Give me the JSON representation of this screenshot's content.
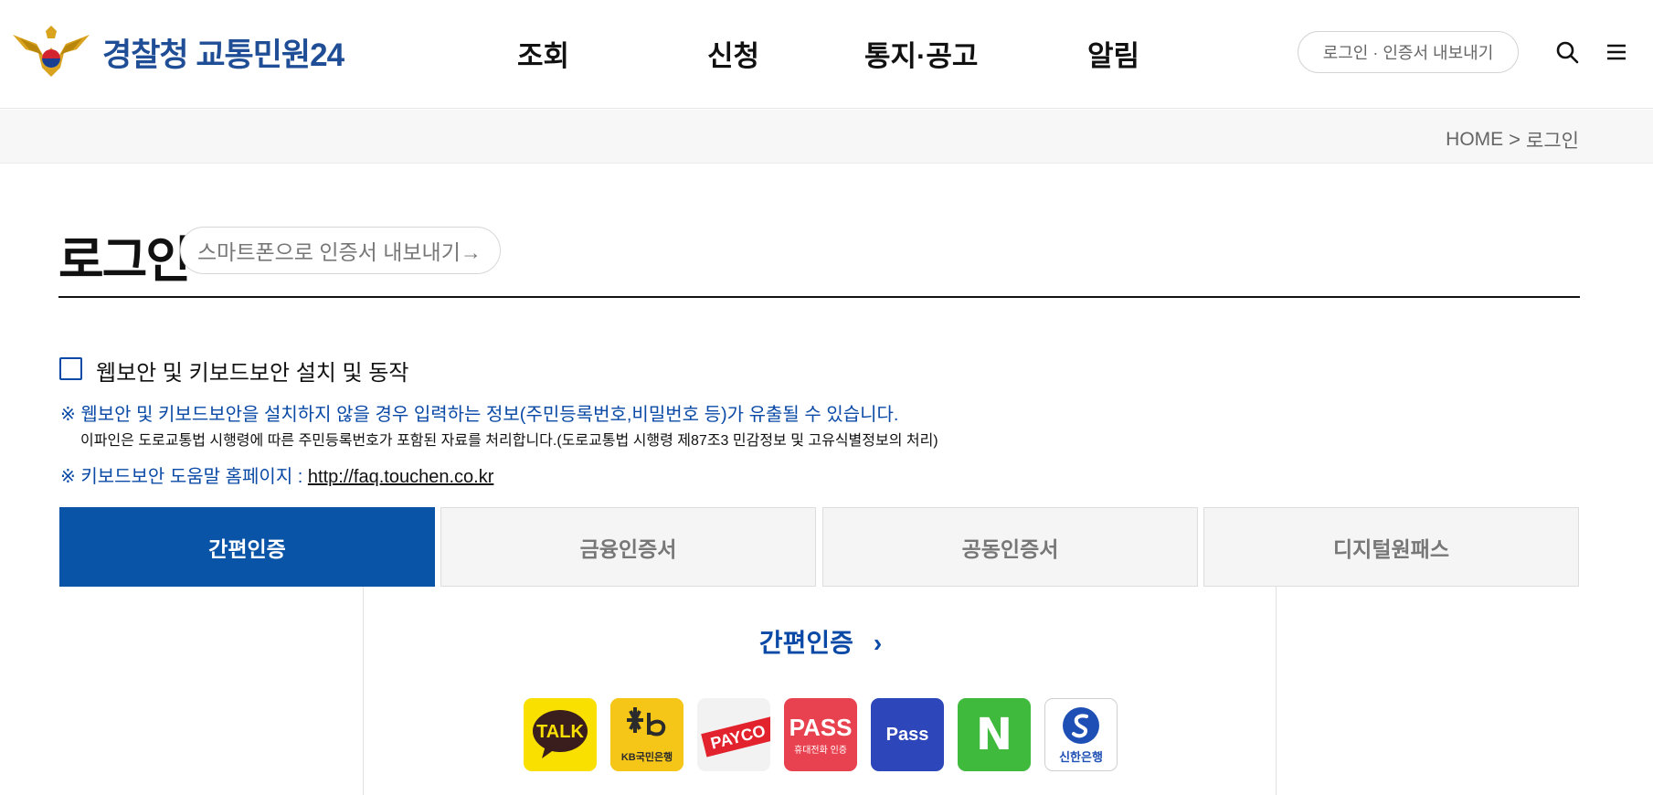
{
  "header": {
    "logo_text": "경찰청 교통민원24",
    "nav": [
      "조회",
      "신청",
      "통지·공고",
      "알림"
    ],
    "login_button": "로그인 · 인증서 내보내기",
    "search_icon": "search-icon",
    "menu_icon": "hamburger-menu-icon"
  },
  "breadcrumb": {
    "home": "HOME",
    "separator": ">",
    "current": "로그인"
  },
  "page": {
    "title": "로그인",
    "export_link": "스마트폰으로 인증서 내보내기→"
  },
  "security": {
    "checkbox_label": "웹보안 및 키보드보안 설치 및 동작",
    "checked": false,
    "notice1": "※ 웹보안 및 키보드보안을 설치하지 않을 경우 입력하는 정보(주민등록번호,비밀번호 등)가 유출될 수 있습니다.",
    "notice2": "이파인은 도로교통법 시행령에 따른 주민등록번호가 포함된 자료를 처리합니다.(도로교통법 시행령 제87조3 민감정보 및 고유식별정보의 처리)",
    "notice3_prefix": "※ 키보드보안 도움말 홈페이지 : ",
    "notice3_link": "http://faq.touchen.co.kr"
  },
  "tabs": [
    {
      "label": "간편인증",
      "active": true
    },
    {
      "label": "금융인증서",
      "active": false
    },
    {
      "label": "공동인증서",
      "active": false
    },
    {
      "label": "디지털원패스",
      "active": false
    }
  ],
  "simple_auth": {
    "title": "간편인증",
    "chevron": "›",
    "providers": [
      {
        "name": "kakao-talk",
        "text": "TALK",
        "color": "#f9e000"
      },
      {
        "name": "kb-bank",
        "text": "KB국민은행",
        "color": "#f5c518"
      },
      {
        "name": "payco",
        "text": "PAYCO",
        "color": "#f2f2f2"
      },
      {
        "name": "pass-carrier",
        "text": "PASS",
        "subtext": "휴대전화 인증",
        "color": "#e8414f"
      },
      {
        "name": "pass",
        "text": "Pass",
        "color": "#2d46b9"
      },
      {
        "name": "naver",
        "text": "N",
        "color": "#3fba3c"
      },
      {
        "name": "shinhan",
        "text": "신한은행",
        "color": "#ffffff"
      }
    ]
  },
  "colors": {
    "brand_blue": "#0a54a8",
    "notice_blue": "#0a4aa6",
    "logo_blue": "#1f4e96"
  }
}
